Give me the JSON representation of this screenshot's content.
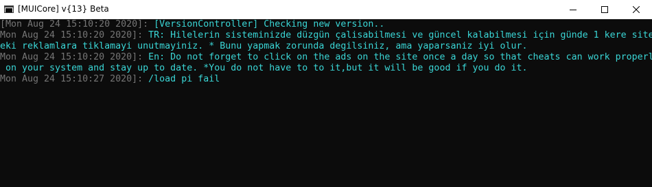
{
  "window": {
    "title": "[MUICore] v{13} Beta",
    "controls": {
      "minimize_icon": "minimize-icon",
      "maximize_icon": "maximize-icon",
      "close_icon": "close-icon"
    }
  },
  "colors": {
    "background": "#0c0c0c",
    "timestamp": "#767676",
    "message": "#3ad6d6"
  },
  "console": {
    "lines": [
      {
        "timestamp": "[Mon Aug 24 15:10:20 2020]: ",
        "text": "[VersionController] Checking new version.."
      },
      {
        "timestamp": "[Mon Aug 24 15:10:20 2020]: ",
        "text": "TR: Hilelerin sisteminizde düzgün çalisabilmesi ve güncel kalabilmesi için günde 1 kere site"
      },
      {
        "timestamp": "",
        "text": "deki reklamlara tiklamayi unutmayiniz. * Bunu yapmak zorunda degilsiniz, ama yaparsaniz iyi olur."
      },
      {
        "timestamp": "[Mon Aug 24 15:10:20 2020]: ",
        "text": "En: Do not forget to click on the ads on the site once a day so that cheats can work properl"
      },
      {
        "timestamp": "",
        "text": "y on your system and stay up to date. *You do not have to to it,but it will be good if you do it."
      },
      {
        "timestamp": "[Mon Aug 24 15:10:27 2020]: ",
        "text": "/load pi fail"
      }
    ]
  }
}
